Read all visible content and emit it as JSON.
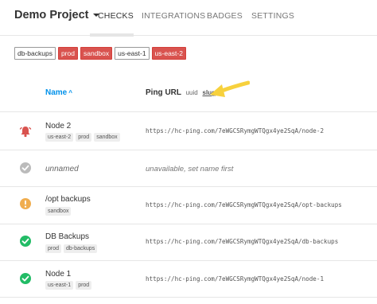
{
  "navbar": {
    "project": "Demo Project",
    "tabs": [
      "CHECKS",
      "INTEGRATIONS",
      "BADGES",
      "SETTINGS"
    ],
    "active_tab": "CHECKS"
  },
  "filter_tags": [
    {
      "label": "db-backups",
      "active": false
    },
    {
      "label": "prod",
      "active": true
    },
    {
      "label": "sandbox",
      "active": true
    },
    {
      "label": "us-east-1",
      "active": false
    },
    {
      "label": "us-east-2",
      "active": true
    }
  ],
  "table": {
    "name_header": "Name",
    "sort_indicator": "^",
    "ping_header": "Ping URL",
    "ping_formats": [
      "uuid",
      "slug"
    ],
    "selected_format": "slug"
  },
  "checks": [
    {
      "name": "Node 2",
      "tags": [
        "us-east-2",
        "prod",
        "sandbox"
      ],
      "url": "https://hc-ping.com/7eWGCSRymgWTQgx4ye2SqA/node-2",
      "status": "down",
      "status_color": "#d9534f"
    },
    {
      "name": "unnamed",
      "tags": [],
      "url": "unavailable, set name first",
      "status": "paused",
      "status_color": "#bbbbbb"
    },
    {
      "name": "/opt backups",
      "tags": [
        "sandbox"
      ],
      "url": "https://hc-ping.com/7eWGCSRymgWTQgx4ye2SqA/opt-backups",
      "status": "grace",
      "status_color": "#f0ad4e"
    },
    {
      "name": "DB Backups",
      "tags": [
        "prod",
        "db-backups"
      ],
      "url": "https://hc-ping.com/7eWGCSRymgWTQgx4ye2SqA/db-backups",
      "status": "up",
      "status_color": "#22bc66"
    },
    {
      "name": "Node 1",
      "tags": [
        "us-east-1",
        "prod"
      ],
      "url": "https://hc-ping.com/7eWGCSRymgWTQgx4ye2SqA/node-1",
      "status": "up",
      "status_color": "#22bc66"
    }
  ],
  "colors": {
    "link": "#0091ea",
    "tag_active": "#d9534f",
    "arrow": "#f7d13d"
  }
}
